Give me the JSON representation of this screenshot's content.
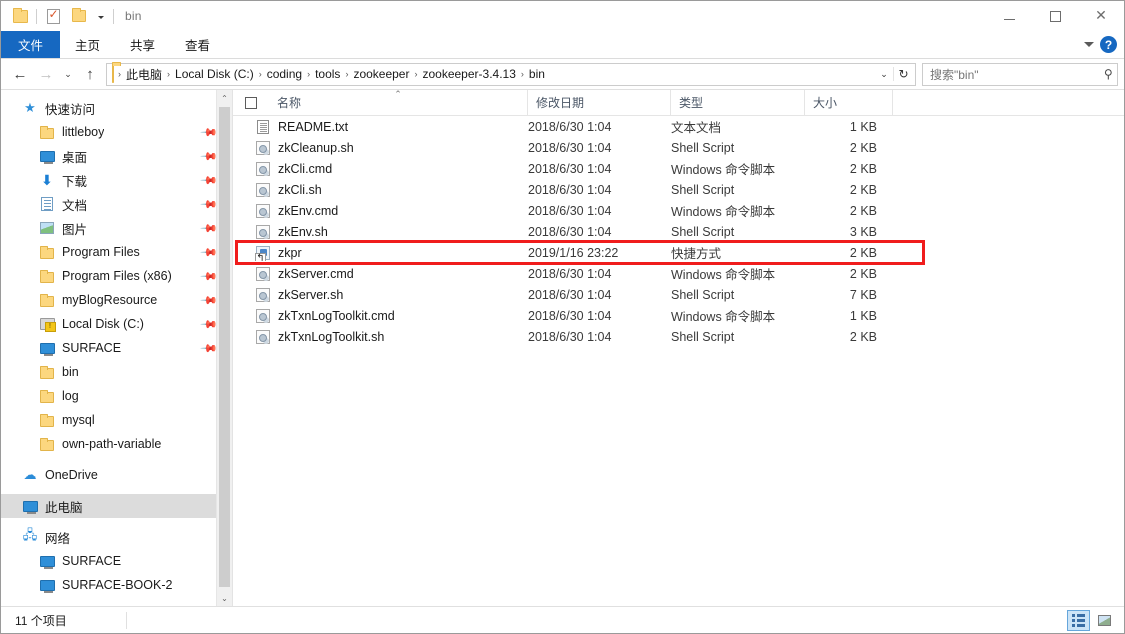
{
  "window": {
    "title": "bin",
    "controls": {
      "minimize": "—",
      "maximize": "□",
      "close": "✕"
    }
  },
  "quick_access_toolbar": {
    "items": [
      {
        "name": "folder-icon",
        "label": ""
      },
      {
        "name": "properties-icon",
        "label": ""
      },
      {
        "name": "new-folder-icon",
        "label": ""
      },
      {
        "name": "customize-dropdown-icon",
        "label": ""
      }
    ]
  },
  "ribbon": {
    "tabs": [
      {
        "label": "文件",
        "active": true
      },
      {
        "label": "主页",
        "active": false
      },
      {
        "label": "共享",
        "active": false
      },
      {
        "label": "查看",
        "active": false
      }
    ],
    "expand_icon": "chevron-down-icon",
    "help_label": "?"
  },
  "navigation": {
    "back_label": "←",
    "forward_label": "→",
    "recent_label": "⌄",
    "up_label": "↑",
    "breadcrumbs": [
      "此电脑",
      "Local Disk (C:)",
      "coding",
      "tools",
      "zookeeper",
      "zookeeper-3.4.13",
      "bin"
    ],
    "separator": "›",
    "address_dropdown": "⌄",
    "refresh_label": "↻"
  },
  "search": {
    "placeholder": "搜索\"bin\"",
    "icon": "search-icon"
  },
  "sidebar": {
    "items": [
      {
        "label": "快速访问",
        "icon": "star-icon",
        "level": 0,
        "pinned": false,
        "selected": false
      },
      {
        "label": "littleboy",
        "icon": "folder-icon",
        "level": 1,
        "pinned": true,
        "selected": false
      },
      {
        "label": "桌面",
        "icon": "monitor-icon",
        "level": 1,
        "pinned": true,
        "selected": false
      },
      {
        "label": "下载",
        "icon": "download-icon",
        "level": 1,
        "pinned": true,
        "selected": false
      },
      {
        "label": "文档",
        "icon": "documents-icon",
        "level": 1,
        "pinned": true,
        "selected": false
      },
      {
        "label": "图片",
        "icon": "pictures-icon",
        "level": 1,
        "pinned": true,
        "selected": false
      },
      {
        "label": "Program Files",
        "icon": "folder-icon",
        "level": 1,
        "pinned": true,
        "selected": false
      },
      {
        "label": "Program Files (x86)",
        "icon": "folder-icon",
        "level": 1,
        "pinned": true,
        "selected": false
      },
      {
        "label": "myBlogResource",
        "icon": "folder-icon",
        "level": 1,
        "pinned": true,
        "selected": false
      },
      {
        "label": "Local Disk (C:)",
        "icon": "disk-warning-icon",
        "level": 1,
        "pinned": true,
        "selected": false
      },
      {
        "label": "SURFACE",
        "icon": "monitor-icon",
        "level": 1,
        "pinned": true,
        "selected": false
      },
      {
        "label": "bin",
        "icon": "folder-icon",
        "level": 1,
        "pinned": false,
        "selected": false
      },
      {
        "label": "log",
        "icon": "folder-icon",
        "level": 1,
        "pinned": false,
        "selected": false
      },
      {
        "label": "mysql",
        "icon": "folder-icon",
        "level": 1,
        "pinned": false,
        "selected": false
      },
      {
        "label": "own-path-variable",
        "icon": "folder-icon",
        "level": 1,
        "pinned": false,
        "selected": false
      },
      {
        "label": "OneDrive",
        "icon": "cloud-icon",
        "level": 0,
        "pinned": false,
        "selected": false
      },
      {
        "label": "此电脑",
        "icon": "monitor-icon",
        "level": 0,
        "pinned": false,
        "selected": true
      },
      {
        "label": "网络",
        "icon": "network-icon",
        "level": 0,
        "pinned": false,
        "selected": false
      },
      {
        "label": "SURFACE",
        "icon": "monitor-icon",
        "level": 1,
        "pinned": false,
        "selected": false
      },
      {
        "label": "SURFACE-BOOK-2",
        "icon": "monitor-icon",
        "level": 1,
        "pinned": false,
        "selected": false
      }
    ],
    "scroll_up": "⌃",
    "scroll_down": "⌄"
  },
  "columns": {
    "name": "名称",
    "date": "修改日期",
    "type": "类型",
    "size": "大小",
    "sort_indicator": "⌃"
  },
  "files": [
    {
      "name": "README.txt",
      "date": "2018/6/30 1:04",
      "type": "文本文档",
      "size": "1 KB",
      "icon": "text-file-icon",
      "highlighted": false
    },
    {
      "name": "zkCleanup.sh",
      "date": "2018/6/30 1:04",
      "type": "Shell Script",
      "size": "2 KB",
      "icon": "generic-file-icon",
      "highlighted": false
    },
    {
      "name": "zkCli.cmd",
      "date": "2018/6/30 1:04",
      "type": "Windows 命令脚本",
      "size": "2 KB",
      "icon": "generic-file-icon",
      "highlighted": false
    },
    {
      "name": "zkCli.sh",
      "date": "2018/6/30 1:04",
      "type": "Shell Script",
      "size": "2 KB",
      "icon": "generic-file-icon",
      "highlighted": false
    },
    {
      "name": "zkEnv.cmd",
      "date": "2018/6/30 1:04",
      "type": "Windows 命令脚本",
      "size": "2 KB",
      "icon": "generic-file-icon",
      "highlighted": false
    },
    {
      "name": "zkEnv.sh",
      "date": "2018/6/30 1:04",
      "type": "Shell Script",
      "size": "3 KB",
      "icon": "generic-file-icon",
      "highlighted": false
    },
    {
      "name": "zkpr",
      "date": "2019/1/16 23:22",
      "type": "快捷方式",
      "size": "2 KB",
      "icon": "shortcut-icon",
      "highlighted": true
    },
    {
      "name": "zkServer.cmd",
      "date": "2018/6/30 1:04",
      "type": "Windows 命令脚本",
      "size": "2 KB",
      "icon": "generic-file-icon",
      "highlighted": false
    },
    {
      "name": "zkServer.sh",
      "date": "2018/6/30 1:04",
      "type": "Shell Script",
      "size": "7 KB",
      "icon": "generic-file-icon",
      "highlighted": false
    },
    {
      "name": "zkTxnLogToolkit.cmd",
      "date": "2018/6/30 1:04",
      "type": "Windows 命令脚本",
      "size": "1 KB",
      "icon": "generic-file-icon",
      "highlighted": false
    },
    {
      "name": "zkTxnLogToolkit.sh",
      "date": "2018/6/30 1:04",
      "type": "Shell Script",
      "size": "2 KB",
      "icon": "generic-file-icon",
      "highlighted": false
    }
  ],
  "annotation": {
    "highlight_color": "#f01c1c",
    "target_row_index": 6
  },
  "statusbar": {
    "item_count": "11 个项目",
    "details_view_icon": "details-view-icon",
    "large_icons_view_icon": "large-icons-view-icon"
  },
  "colors": {
    "accent": "#1668c1",
    "selection": "#dcdcdc",
    "highlight": "#f01c1c"
  }
}
